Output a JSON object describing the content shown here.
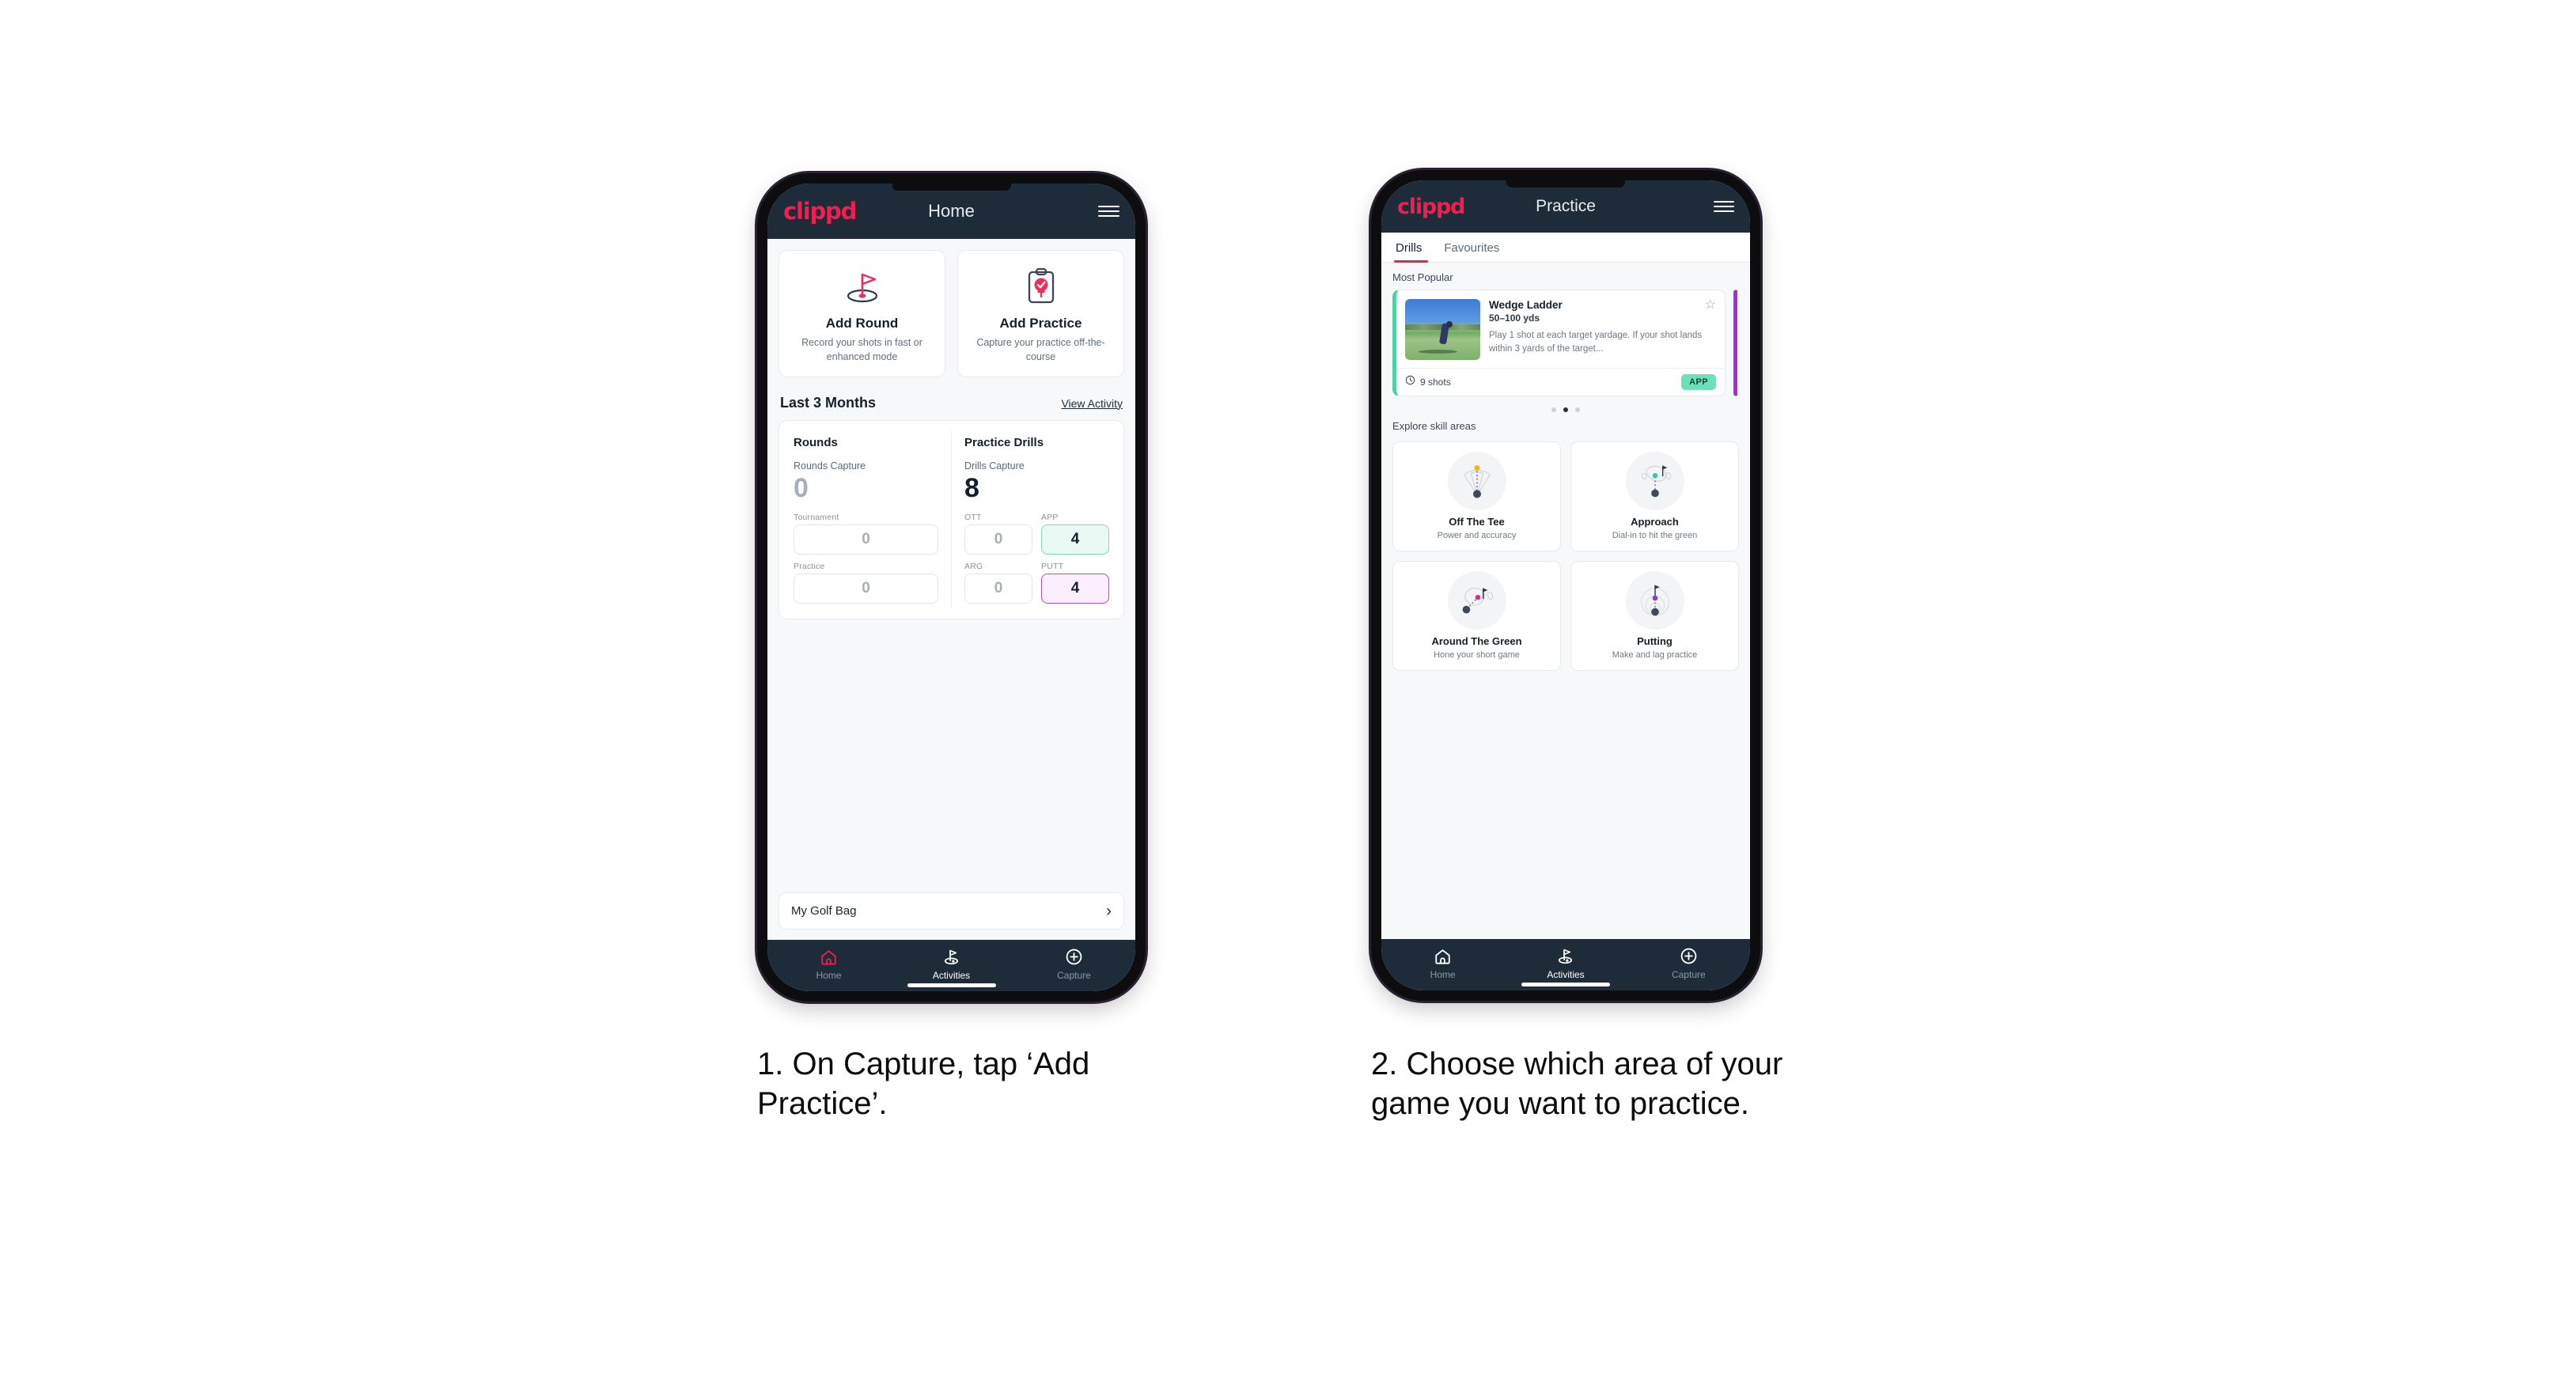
{
  "phone1": {
    "appbar": {
      "logo": "clippd",
      "title": "Home",
      "menu_icon": "hamburger-icon"
    },
    "quick_actions": [
      {
        "icon": "golf-flag-hole-icon",
        "title": "Add Round",
        "subtitle": "Record your shots in fast or enhanced mode"
      },
      {
        "icon": "clipboard-check-tee-icon",
        "title": "Add Practice",
        "subtitle": "Capture your practice off-the-course"
      }
    ],
    "section": {
      "title": "Last 3 Months",
      "link": "View Activity"
    },
    "stats": {
      "rounds": {
        "heading": "Rounds",
        "caption": "Rounds Capture",
        "total": "0",
        "metrics": [
          {
            "label": "Tournament",
            "value": "0",
            "highlight": "none"
          },
          {
            "label": "Practice",
            "value": "0",
            "highlight": "none"
          }
        ]
      },
      "drills": {
        "heading": "Practice Drills",
        "caption": "Drills Capture",
        "total": "8",
        "metrics": [
          {
            "label": "OTT",
            "value": "0",
            "highlight": "none"
          },
          {
            "label": "APP",
            "value": "4",
            "highlight": "green"
          },
          {
            "label": "ARG",
            "value": "0",
            "highlight": "none"
          },
          {
            "label": "PUTT",
            "value": "4",
            "highlight": "purple"
          }
        ]
      }
    },
    "golf_bag": {
      "label": "My Golf Bag",
      "chevron": "chevron-right-icon"
    },
    "bottom_nav": [
      {
        "icon": "home-icon",
        "label": "Home",
        "state": "active-pink"
      },
      {
        "icon": "golf-flag-icon",
        "label": "Activities",
        "state": "active"
      },
      {
        "icon": "plus-circle-icon",
        "label": "Capture",
        "state": "inactive"
      }
    ]
  },
  "phone2": {
    "appbar": {
      "logo": "clippd",
      "title": "Practice",
      "menu_icon": "hamburger-icon"
    },
    "tabs": [
      {
        "label": "Drills",
        "active": true
      },
      {
        "label": "Favourites",
        "active": false
      }
    ],
    "most_popular_label": "Most Popular",
    "drill_card": {
      "title": "Wedge Ladder",
      "range": "50–100 yds",
      "description": "Play 1 shot at each target yardage. If your shot lands within 3 yards of the target...",
      "shots": "9 shots",
      "shots_icon": "clock-icon",
      "tag": "APP",
      "favourite_icon": "star-outline-icon",
      "accent_color": "#4fd1a8",
      "next_card_accent": "#a32fd8"
    },
    "carousel_dots": {
      "count": 3,
      "active_index": 1
    },
    "explore_label": "Explore skill areas",
    "skill_areas": [
      {
        "icon": "tee-shot-dispersion-icon",
        "name": "Off The Tee",
        "subtitle": "Power and accuracy"
      },
      {
        "icon": "approach-green-icon",
        "name": "Approach",
        "subtitle": "Dial-in to hit the green"
      },
      {
        "icon": "chip-around-green-icon",
        "name": "Around The Green",
        "subtitle": "Hone your short game"
      },
      {
        "icon": "putting-rings-icon",
        "name": "Putting",
        "subtitle": "Make and lag practice"
      }
    ],
    "bottom_nav": [
      {
        "icon": "home-icon",
        "label": "Home",
        "state": "inactive"
      },
      {
        "icon": "golf-flag-icon",
        "label": "Activities",
        "state": "active"
      },
      {
        "icon": "plus-circle-icon",
        "label": "Capture",
        "state": "inactive"
      }
    ]
  },
  "captions": {
    "one": "1. On Capture, tap ‘Add Practice’.",
    "two": "2. Choose which area of your game you want to practice."
  },
  "colors": {
    "brand_pink": "#ef1f52",
    "header_navy": "#1e2b38",
    "app_green": "#6ee0b8",
    "putt_purple": "#b14fd4",
    "page_bg": "#f7f8fa"
  }
}
